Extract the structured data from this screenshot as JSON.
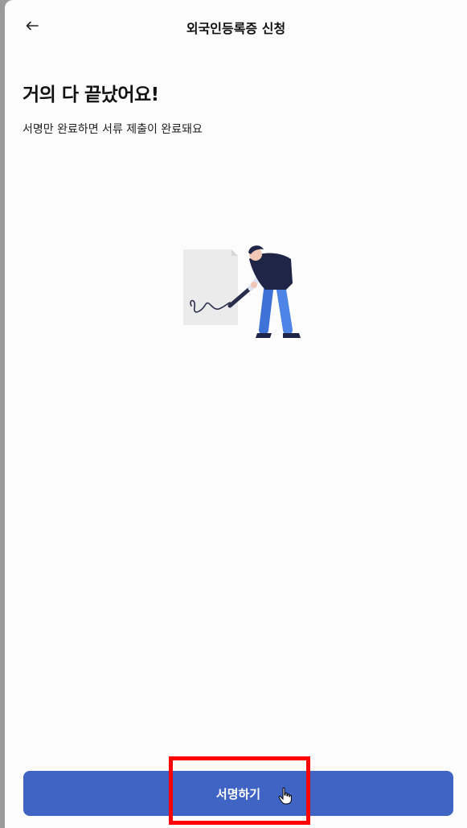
{
  "app_bar": {
    "back_icon": "arrow-left-icon",
    "title": "외국인등록증 신청"
  },
  "main": {
    "headline": "거의 다 끝났어요!",
    "subline": "서명만 완료하면 서류 제출이 완료돼요",
    "illustration": "person-signing-document-illustration"
  },
  "footer": {
    "sign_button_label": "서명하기",
    "cursor_icon": "hand-pointer-icon"
  },
  "colors": {
    "primary": "#3f64c4",
    "background": "#fcfcfc",
    "highlight": "#ff0000"
  }
}
